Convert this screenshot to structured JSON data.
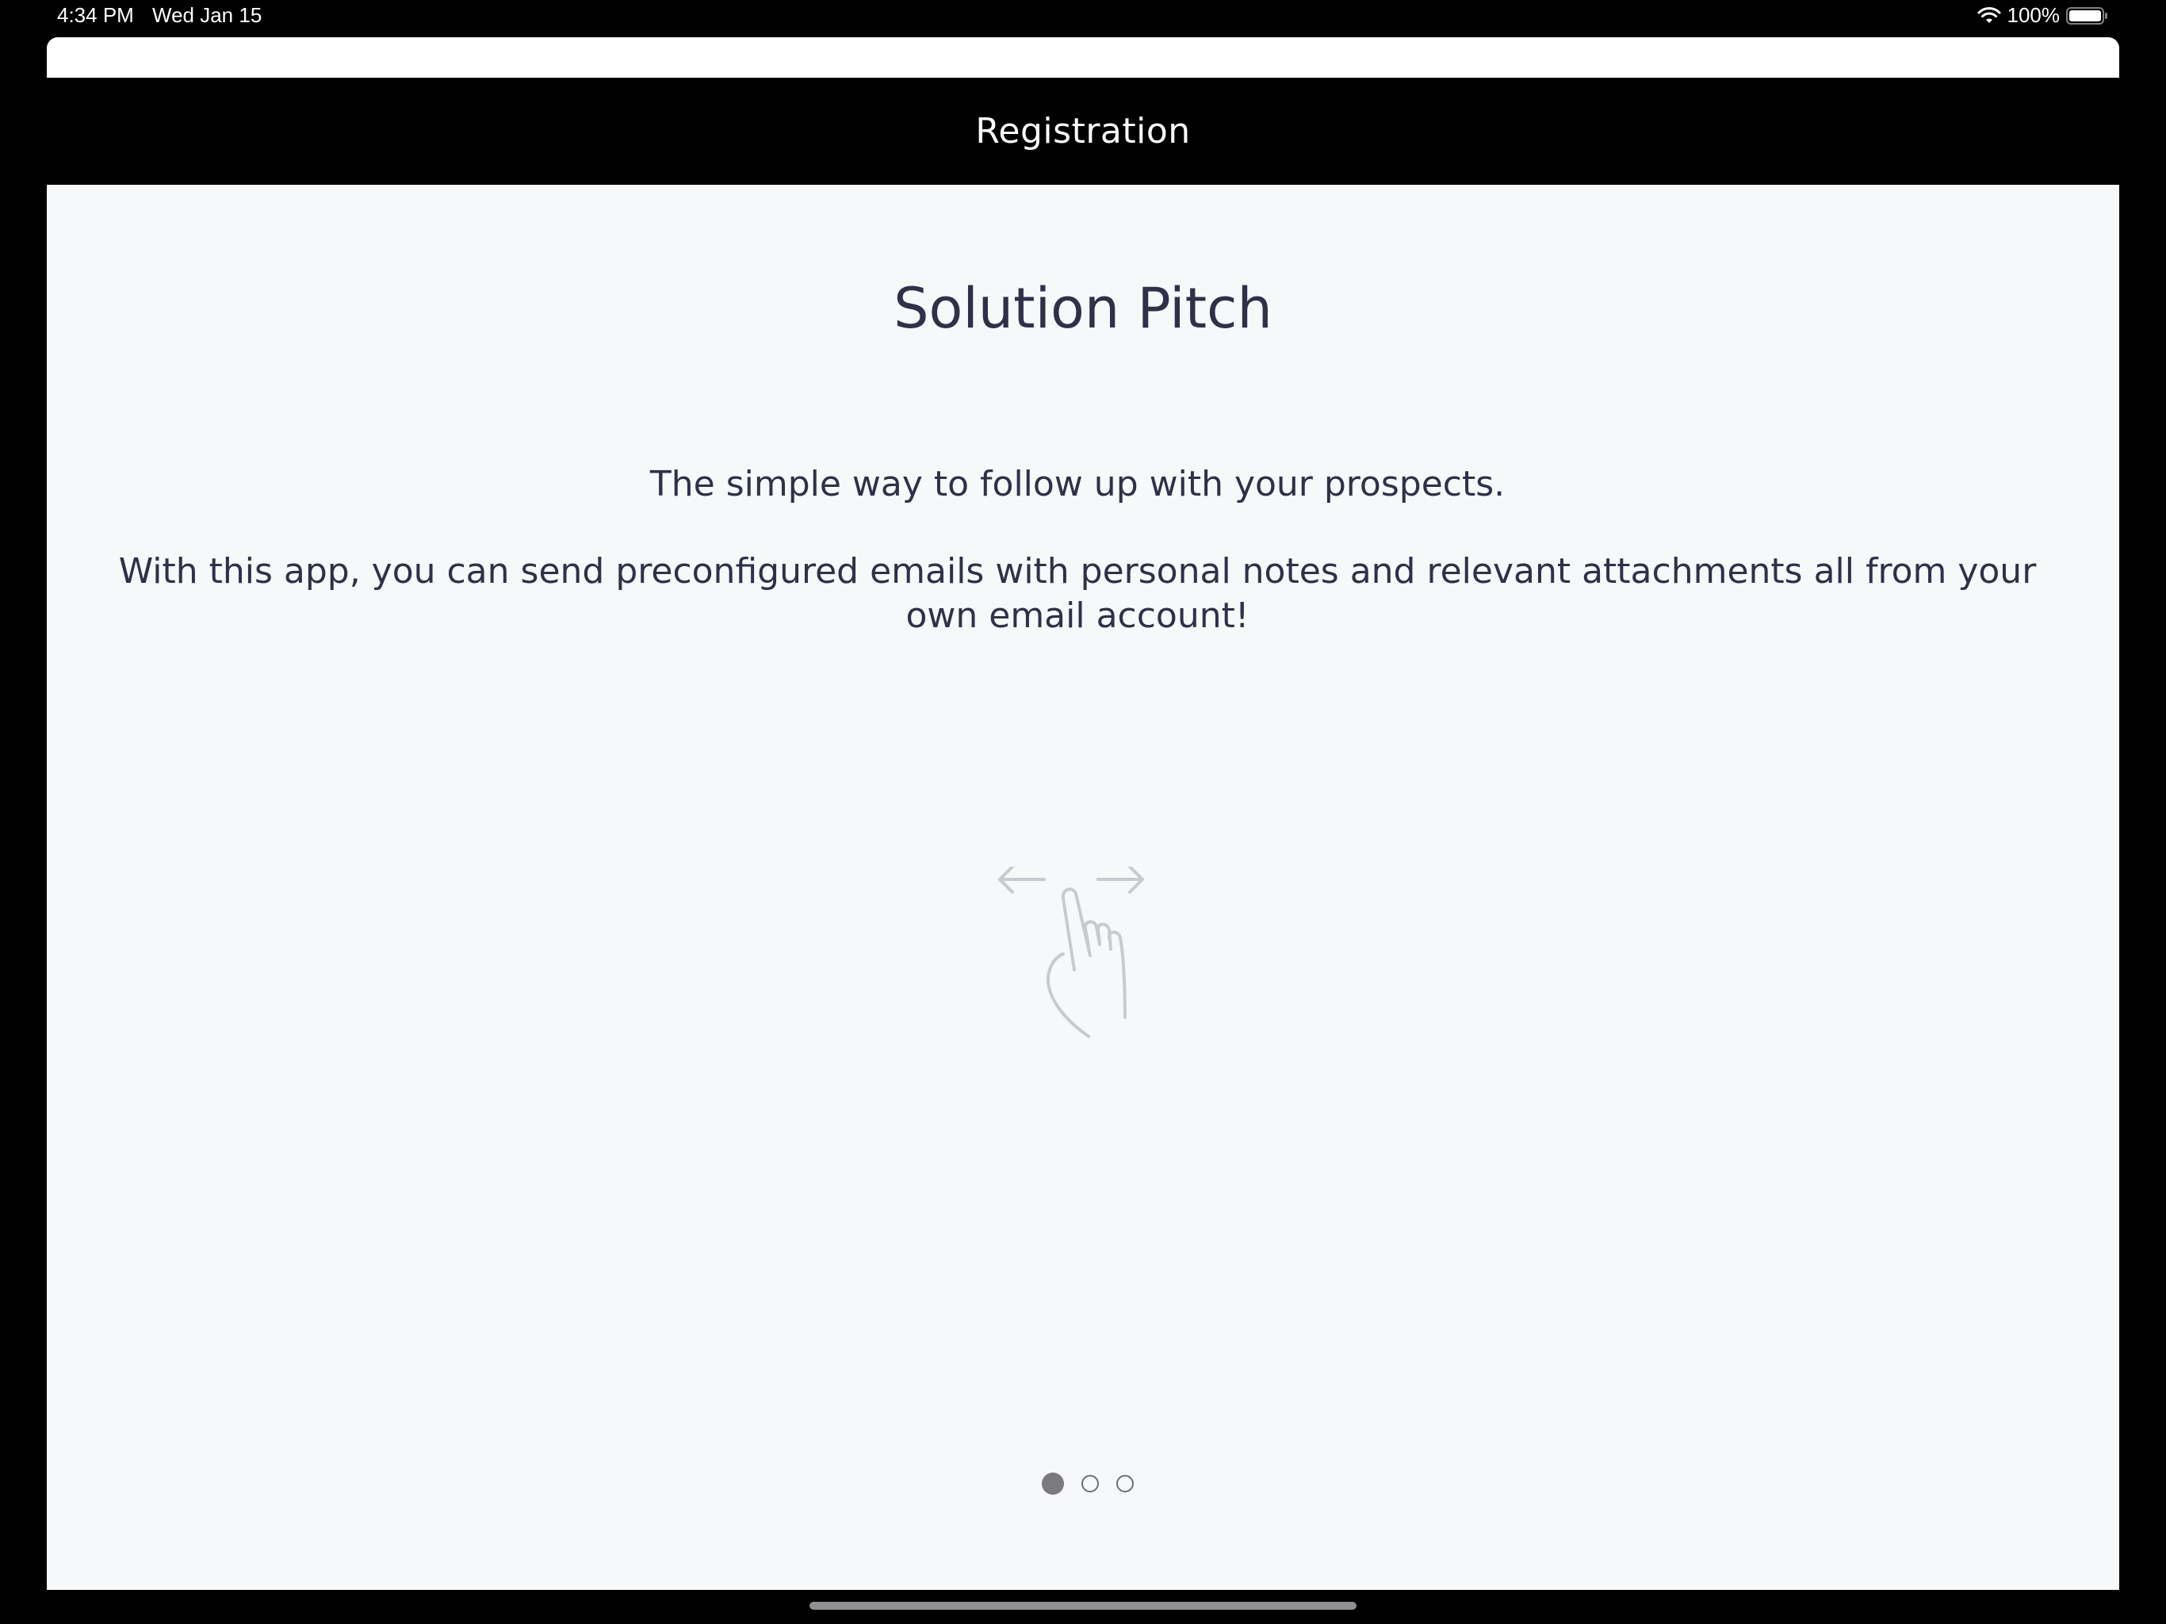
{
  "status_bar": {
    "time": "4:34 PM",
    "date": "Wed Jan 15",
    "battery": "100%",
    "wifi_icon": "wifi-icon",
    "battery_icon": "battery-icon"
  },
  "nav": {
    "title": "Registration"
  },
  "onboarding": {
    "title": "Solution Pitch",
    "tagline": "The simple way to follow up with your prospects.",
    "description": "With this app, you can send preconfigured emails with personal notes and relevant attachments all from your own email account!",
    "illustration_icon": "swipe-gesture-icon"
  },
  "pager": {
    "total_pages": 3,
    "current_page": 1
  },
  "colors": {
    "nav_background": "#000000",
    "content_background": "#f7f8fa",
    "text": "#2e3147",
    "icon_stroke": "#c8cad0",
    "dot_active": "#7a7a7f"
  }
}
